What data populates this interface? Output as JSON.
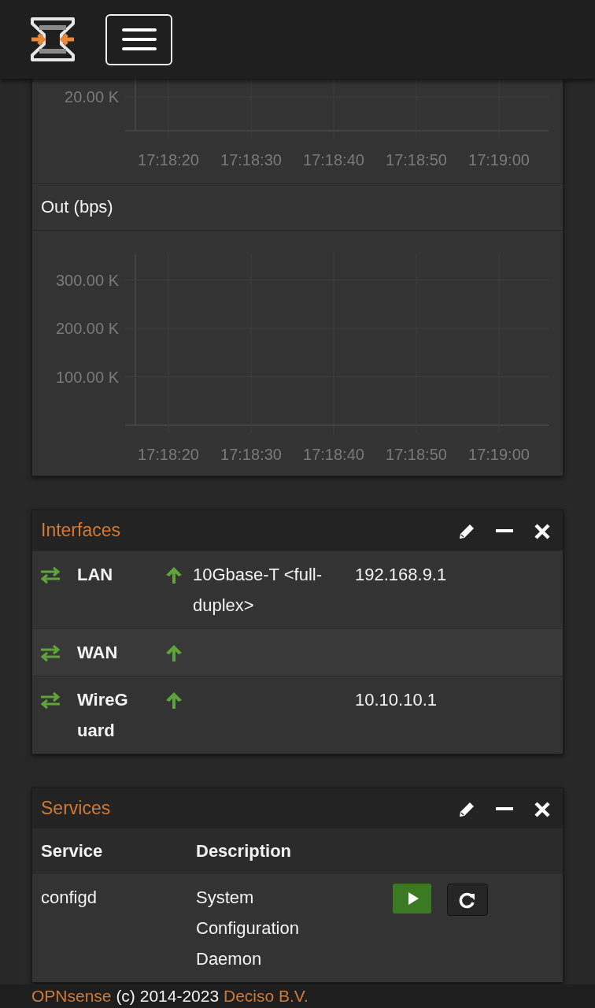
{
  "traffic_graphs": [
    {
      "y_ticks": [
        "20.00 K"
      ],
      "x_ticks": [
        "17:18:20",
        "17:18:30",
        "17:18:40",
        "17:18:50",
        "17:19:00"
      ]
    },
    {
      "title": "Out (bps)",
      "y_ticks": [
        "300.00 K",
        "200.00 K",
        "100.00 K"
      ],
      "x_ticks": [
        "17:18:20",
        "17:18:30",
        "17:18:40",
        "17:18:50",
        "17:19:00"
      ]
    }
  ],
  "interfaces": {
    "title": "Interfaces",
    "rows": [
      {
        "name": "LAN",
        "link_up": true,
        "media": "10Gbase-T <full-duplex>",
        "ip": "192.168.9.1"
      },
      {
        "name": "WAN",
        "link_up": true
      },
      {
        "name": "WireGuard",
        "link_up": true,
        "ip": "10.10.10.1"
      }
    ]
  },
  "services": {
    "title": "Services",
    "columns": [
      "Service",
      "Description"
    ],
    "rows": [
      {
        "name": "configd",
        "description": "System Configuration Daemon",
        "running": true
      }
    ]
  },
  "footer": {
    "brand": "OPNsense",
    "text": "(c) 2014-2023",
    "company": "Deciso B.V."
  }
}
